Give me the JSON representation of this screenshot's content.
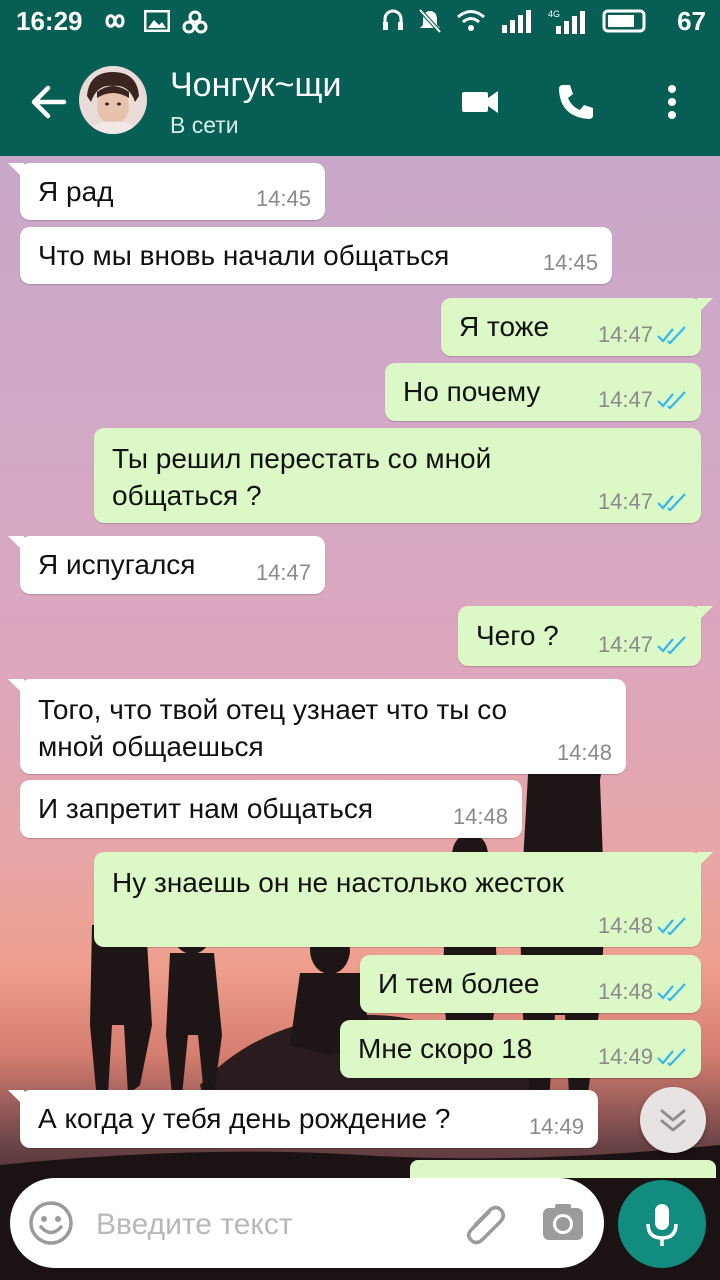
{
  "status_bar": {
    "time": "16:29",
    "battery": "67"
  },
  "header": {
    "contact_name": "Чонгук~щи",
    "contact_status": "В сети"
  },
  "messages": [
    {
      "dir": "in",
      "text": "Я рад",
      "time": "14:45"
    },
    {
      "dir": "in",
      "text": "Что мы вновь начали общаться",
      "time": "14:45"
    },
    {
      "dir": "out",
      "text": "Я тоже",
      "time": "14:47"
    },
    {
      "dir": "out",
      "text": "Но почему",
      "time": "14:47"
    },
    {
      "dir": "out",
      "text": "Ты решил перестать со мной\nобщаться ?",
      "time": "14:47"
    },
    {
      "dir": "in",
      "text": "Я испугался",
      "time": "14:47"
    },
    {
      "dir": "out",
      "text": "Чего ?",
      "time": "14:47"
    },
    {
      "dir": "in",
      "text": "Того, что твой отец узнает что ты со\nмной общаешься",
      "time": "14:48"
    },
    {
      "dir": "in",
      "text": "И запретит нам общаться",
      "time": "14:48"
    },
    {
      "dir": "out",
      "text": "Ну знаешь он не настолько жесток",
      "time": "14:48"
    },
    {
      "dir": "out",
      "text": "И тем более",
      "time": "14:48"
    },
    {
      "dir": "out",
      "text": "Мне скоро 18",
      "time": "14:49"
    },
    {
      "dir": "in",
      "text": "А когда у тебя день рождение ?",
      "time": "14:49"
    }
  ],
  "composer": {
    "placeholder": "Введите текст"
  },
  "colors": {
    "header": "#075e55",
    "outgoing": "#dcf8c6",
    "incoming": "#ffffff",
    "read_ticks": "#34b7f1",
    "mic": "#128c7e"
  }
}
